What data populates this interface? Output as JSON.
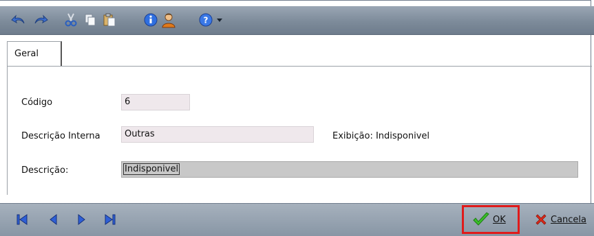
{
  "toolbar": {
    "icons": [
      "undo-icon",
      "redo-icon",
      "cut-icon",
      "copy-icon",
      "paste-icon",
      "info-icon",
      "user-icon",
      "help-icon",
      "dropdown-arrow-icon"
    ]
  },
  "tabs": [
    {
      "label": "Geral",
      "active": true
    }
  ],
  "form": {
    "codigo_label": "Código",
    "codigo_value": "6",
    "descricao_interna_label": "Descrição Interna",
    "descricao_interna_value": "Outras",
    "exibicao_text": "Exibição: Indisponivel",
    "descricao_label": "Descrição:",
    "descricao_value": "Indisponivel"
  },
  "navigation": {
    "icons": [
      "first-record-icon",
      "previous-record-icon",
      "next-record-icon",
      "last-record-icon"
    ]
  },
  "buttons": {
    "ok_label": "OK",
    "cancel_label": "Cancela"
  },
  "colors": {
    "toolbar": "#7d8b9a",
    "nav_icon": "#2f5fd6",
    "highlight": "#e01a1a",
    "ok_check": "#3bbf2a",
    "cancel_x": "#e02a1a"
  }
}
